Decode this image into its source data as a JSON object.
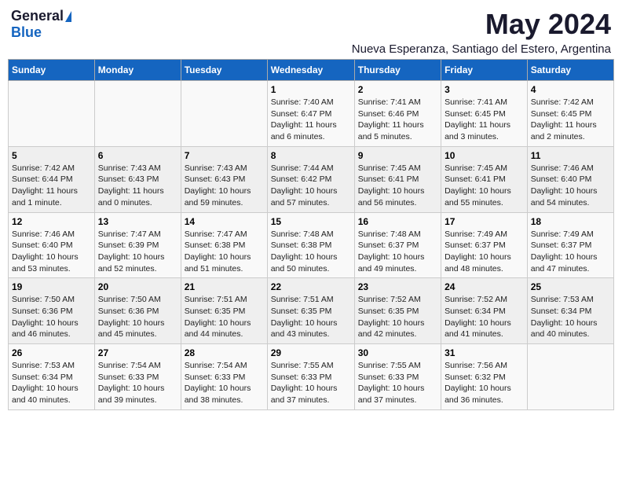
{
  "header": {
    "logo_general": "General",
    "logo_blue": "Blue",
    "main_title": "May 2024",
    "subtitle": "Nueva Esperanza, Santiago del Estero, Argentina"
  },
  "days_of_week": [
    "Sunday",
    "Monday",
    "Tuesday",
    "Wednesday",
    "Thursday",
    "Friday",
    "Saturday"
  ],
  "weeks": [
    [
      {
        "day": "",
        "info": ""
      },
      {
        "day": "",
        "info": ""
      },
      {
        "day": "",
        "info": ""
      },
      {
        "day": "1",
        "info": "Sunrise: 7:40 AM\nSunset: 6:47 PM\nDaylight: 11 hours and 6 minutes."
      },
      {
        "day": "2",
        "info": "Sunrise: 7:41 AM\nSunset: 6:46 PM\nDaylight: 11 hours and 5 minutes."
      },
      {
        "day": "3",
        "info": "Sunrise: 7:41 AM\nSunset: 6:45 PM\nDaylight: 11 hours and 3 minutes."
      },
      {
        "day": "4",
        "info": "Sunrise: 7:42 AM\nSunset: 6:45 PM\nDaylight: 11 hours and 2 minutes."
      }
    ],
    [
      {
        "day": "5",
        "info": "Sunrise: 7:42 AM\nSunset: 6:44 PM\nDaylight: 11 hours and 1 minute."
      },
      {
        "day": "6",
        "info": "Sunrise: 7:43 AM\nSunset: 6:43 PM\nDaylight: 11 hours and 0 minutes."
      },
      {
        "day": "7",
        "info": "Sunrise: 7:43 AM\nSunset: 6:43 PM\nDaylight: 10 hours and 59 minutes."
      },
      {
        "day": "8",
        "info": "Sunrise: 7:44 AM\nSunset: 6:42 PM\nDaylight: 10 hours and 57 minutes."
      },
      {
        "day": "9",
        "info": "Sunrise: 7:45 AM\nSunset: 6:41 PM\nDaylight: 10 hours and 56 minutes."
      },
      {
        "day": "10",
        "info": "Sunrise: 7:45 AM\nSunset: 6:41 PM\nDaylight: 10 hours and 55 minutes."
      },
      {
        "day": "11",
        "info": "Sunrise: 7:46 AM\nSunset: 6:40 PM\nDaylight: 10 hours and 54 minutes."
      }
    ],
    [
      {
        "day": "12",
        "info": "Sunrise: 7:46 AM\nSunset: 6:40 PM\nDaylight: 10 hours and 53 minutes."
      },
      {
        "day": "13",
        "info": "Sunrise: 7:47 AM\nSunset: 6:39 PM\nDaylight: 10 hours and 52 minutes."
      },
      {
        "day": "14",
        "info": "Sunrise: 7:47 AM\nSunset: 6:38 PM\nDaylight: 10 hours and 51 minutes."
      },
      {
        "day": "15",
        "info": "Sunrise: 7:48 AM\nSunset: 6:38 PM\nDaylight: 10 hours and 50 minutes."
      },
      {
        "day": "16",
        "info": "Sunrise: 7:48 AM\nSunset: 6:37 PM\nDaylight: 10 hours and 49 minutes."
      },
      {
        "day": "17",
        "info": "Sunrise: 7:49 AM\nSunset: 6:37 PM\nDaylight: 10 hours and 48 minutes."
      },
      {
        "day": "18",
        "info": "Sunrise: 7:49 AM\nSunset: 6:37 PM\nDaylight: 10 hours and 47 minutes."
      }
    ],
    [
      {
        "day": "19",
        "info": "Sunrise: 7:50 AM\nSunset: 6:36 PM\nDaylight: 10 hours and 46 minutes."
      },
      {
        "day": "20",
        "info": "Sunrise: 7:50 AM\nSunset: 6:36 PM\nDaylight: 10 hours and 45 minutes."
      },
      {
        "day": "21",
        "info": "Sunrise: 7:51 AM\nSunset: 6:35 PM\nDaylight: 10 hours and 44 minutes."
      },
      {
        "day": "22",
        "info": "Sunrise: 7:51 AM\nSunset: 6:35 PM\nDaylight: 10 hours and 43 minutes."
      },
      {
        "day": "23",
        "info": "Sunrise: 7:52 AM\nSunset: 6:35 PM\nDaylight: 10 hours and 42 minutes."
      },
      {
        "day": "24",
        "info": "Sunrise: 7:52 AM\nSunset: 6:34 PM\nDaylight: 10 hours and 41 minutes."
      },
      {
        "day": "25",
        "info": "Sunrise: 7:53 AM\nSunset: 6:34 PM\nDaylight: 10 hours and 40 minutes."
      }
    ],
    [
      {
        "day": "26",
        "info": "Sunrise: 7:53 AM\nSunset: 6:34 PM\nDaylight: 10 hours and 40 minutes."
      },
      {
        "day": "27",
        "info": "Sunrise: 7:54 AM\nSunset: 6:33 PM\nDaylight: 10 hours and 39 minutes."
      },
      {
        "day": "28",
        "info": "Sunrise: 7:54 AM\nSunset: 6:33 PM\nDaylight: 10 hours and 38 minutes."
      },
      {
        "day": "29",
        "info": "Sunrise: 7:55 AM\nSunset: 6:33 PM\nDaylight: 10 hours and 37 minutes."
      },
      {
        "day": "30",
        "info": "Sunrise: 7:55 AM\nSunset: 6:33 PM\nDaylight: 10 hours and 37 minutes."
      },
      {
        "day": "31",
        "info": "Sunrise: 7:56 AM\nSunset: 6:32 PM\nDaylight: 10 hours and 36 minutes."
      },
      {
        "day": "",
        "info": ""
      }
    ]
  ]
}
